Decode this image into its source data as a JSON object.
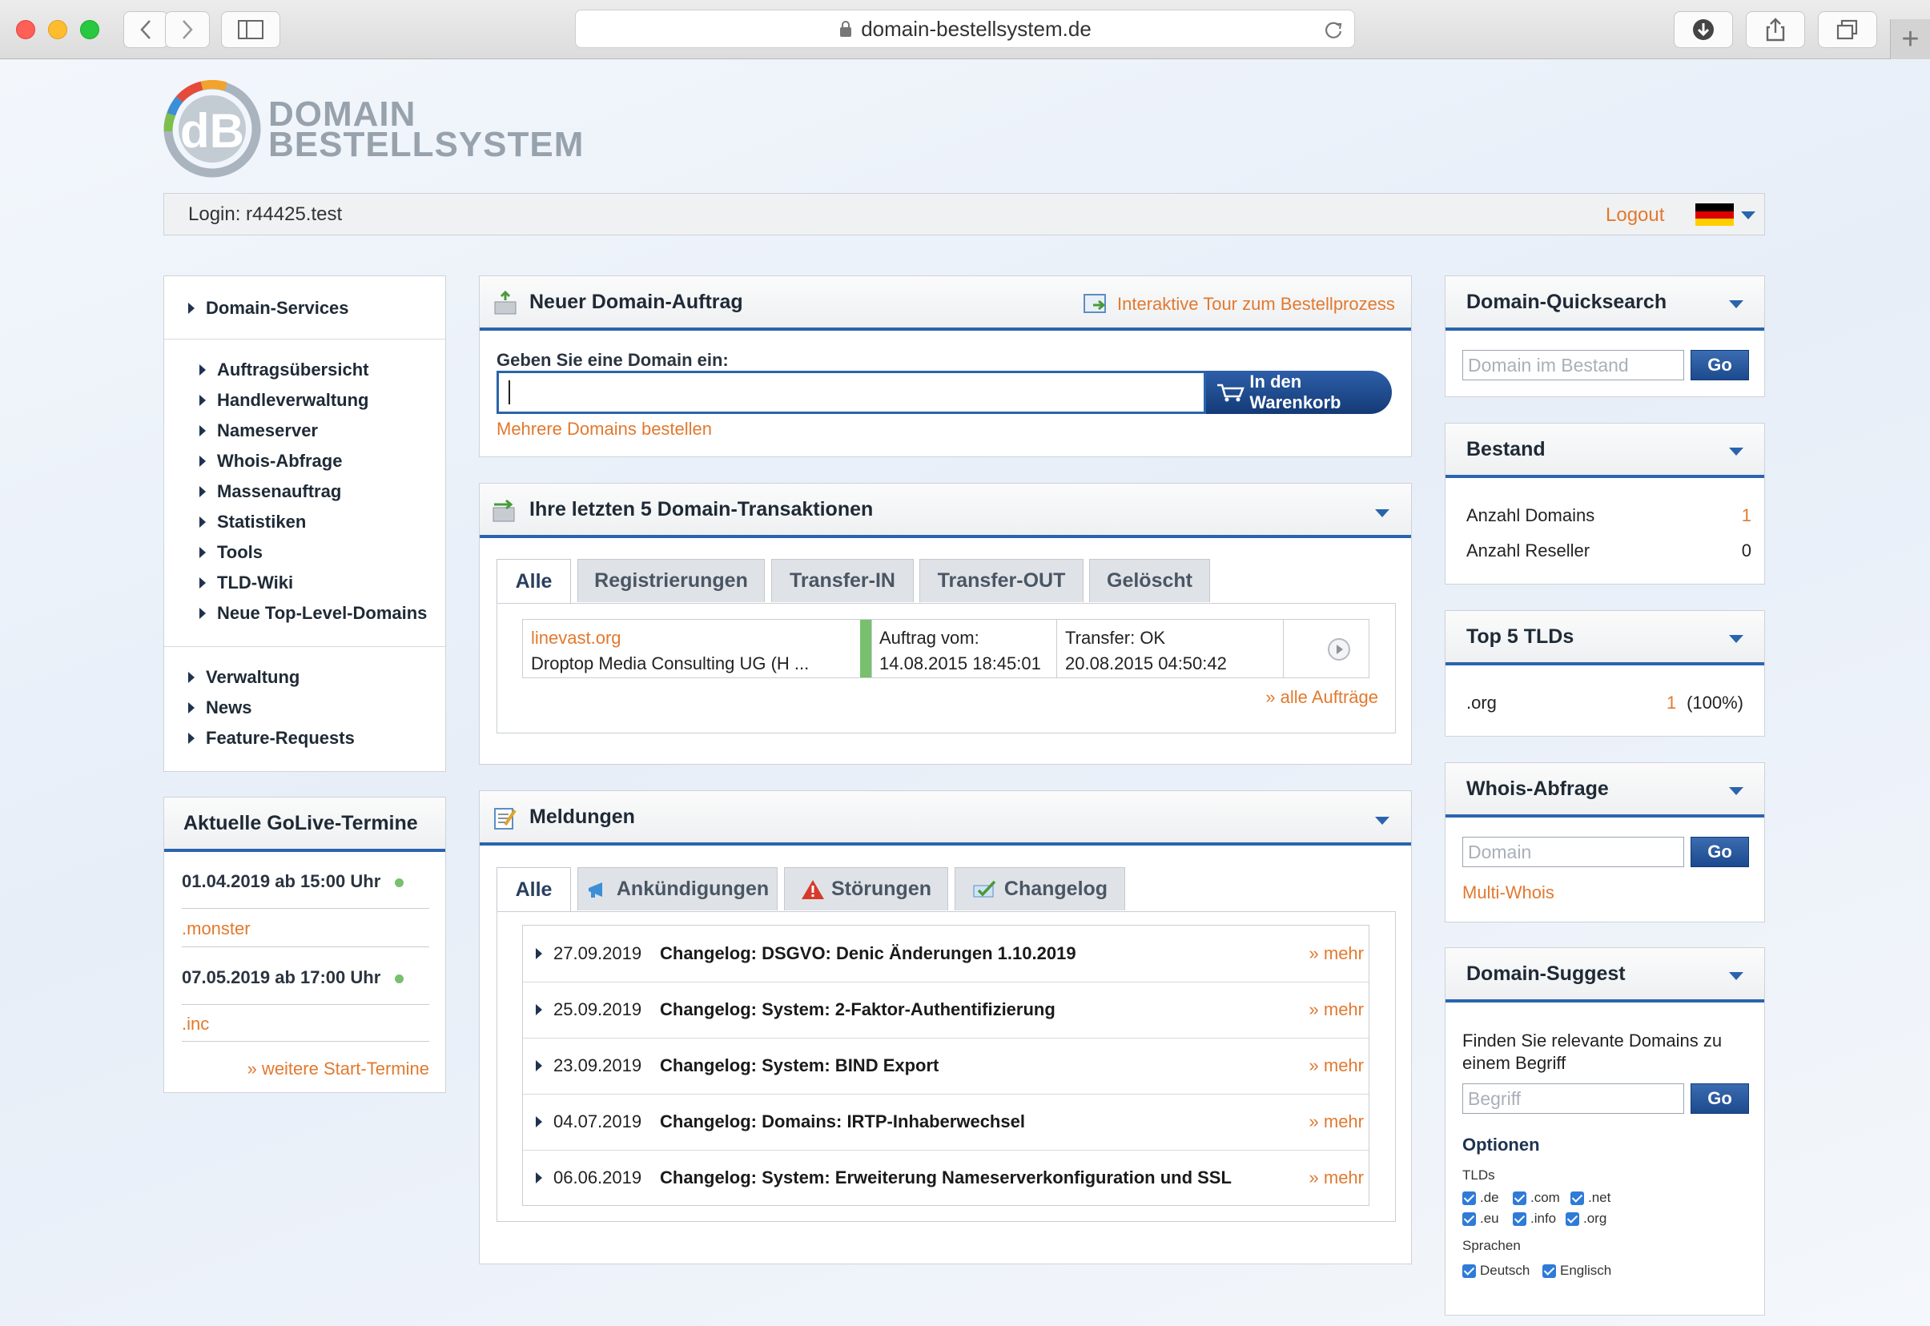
{
  "browser": {
    "url": "domain-bestellsystem.de"
  },
  "logo": {
    "line1": "DOMAIN",
    "line2": "BESTELLSYSTEM",
    "mark": "dB"
  },
  "topbar": {
    "login": "Login: r44425.test",
    "logout": "Logout"
  },
  "sidebar": {
    "section": "Domain-Services",
    "items": [
      "Auftragsübersicht",
      "Handleverwaltung",
      "Nameserver",
      "Whois-Abfrage",
      "Massenauftrag",
      "Statistiken",
      "Tools",
      "TLD-Wiki",
      "Neue Top-Level-Domains"
    ],
    "secondary": [
      "Verwaltung",
      "News",
      "Feature-Requests"
    ]
  },
  "golive": {
    "title": "Aktuelle GoLive-Termine",
    "entries": [
      {
        "date": "01.04.2019 ab 15:00 Uhr",
        "tld": ".monster"
      },
      {
        "date": "07.05.2019 ab 17:00 Uhr",
        "tld": ".inc"
      }
    ],
    "more": "» weitere Start-Termine"
  },
  "order": {
    "title": "Neuer Domain-Auftrag",
    "tour": "Interaktive Tour zum Bestellprozess",
    "label": "Geben Sie eine Domain ein:",
    "input_value": "",
    "cart_button": "In den Warenkorb",
    "multi": "Mehrere Domains bestellen"
  },
  "transactions": {
    "title": "Ihre letzten 5 Domain-Transaktionen",
    "tabs": [
      "Alle",
      "Registrierungen",
      "Transfer-IN",
      "Transfer-OUT",
      "Gelöscht"
    ],
    "row": {
      "domain": "linevast.org",
      "owner": "Droptop Media Consulting UG (H ...",
      "order_label": "Auftrag vom:",
      "order_date": "14.08.2015 18:45:01",
      "status": "Transfer: OK",
      "status_date": "20.08.2015 04:50:42"
    },
    "all_orders": "» alle Aufträge"
  },
  "messages": {
    "title": "Meldungen",
    "tabs": [
      "Alle",
      "Ankündigungen",
      "Störungen",
      "Changelog"
    ],
    "items": [
      {
        "date": "27.09.2019",
        "title": "Changelog: DSGVO: Denic Änderungen 1.10.2019",
        "more": "» mehr"
      },
      {
        "date": "25.09.2019",
        "title": "Changelog: System: 2-Faktor-Authentifizierung",
        "more": "» mehr"
      },
      {
        "date": "23.09.2019",
        "title": "Changelog: System: BIND Export",
        "more": "» mehr"
      },
      {
        "date": "04.07.2019",
        "title": "Changelog: Domains: IRTP-Inhaberwechsel",
        "more": "» mehr"
      },
      {
        "date": "06.06.2019",
        "title": "Changelog: System: Erweiterung Nameserverkonfiguration und SSL",
        "more": "» mehr"
      }
    ]
  },
  "quicksearch": {
    "title": "Domain-Quicksearch",
    "placeholder": "Domain im Bestand",
    "go": "Go"
  },
  "bestand": {
    "title": "Bestand",
    "rows": [
      {
        "label": "Anzahl Domains",
        "value": "1"
      },
      {
        "label": "Anzahl Reseller",
        "value": "0"
      }
    ]
  },
  "top5": {
    "title": "Top 5 TLDs",
    "rows": [
      {
        "tld": ".org",
        "count": "1",
        "pct": "(100%)"
      }
    ]
  },
  "whois": {
    "title": "Whois-Abfrage",
    "placeholder": "Domain",
    "go": "Go",
    "multi": "Multi-Whois"
  },
  "suggest": {
    "title": "Domain-Suggest",
    "desc": "Finden Sie relevante Domains zu einem Begriff",
    "placeholder": "Begriff",
    "go": "Go",
    "options": "Optionen",
    "tlds_label": "TLDs",
    "tlds": [
      ".de",
      ".com",
      ".net",
      ".eu",
      ".info",
      ".org"
    ],
    "lang_label": "Sprachen",
    "langs": [
      "Deutsch",
      "Englisch"
    ]
  },
  "colors": {
    "accent": "#2a64ad",
    "link": "#e2792e",
    "status_ok": "#78c06e"
  }
}
